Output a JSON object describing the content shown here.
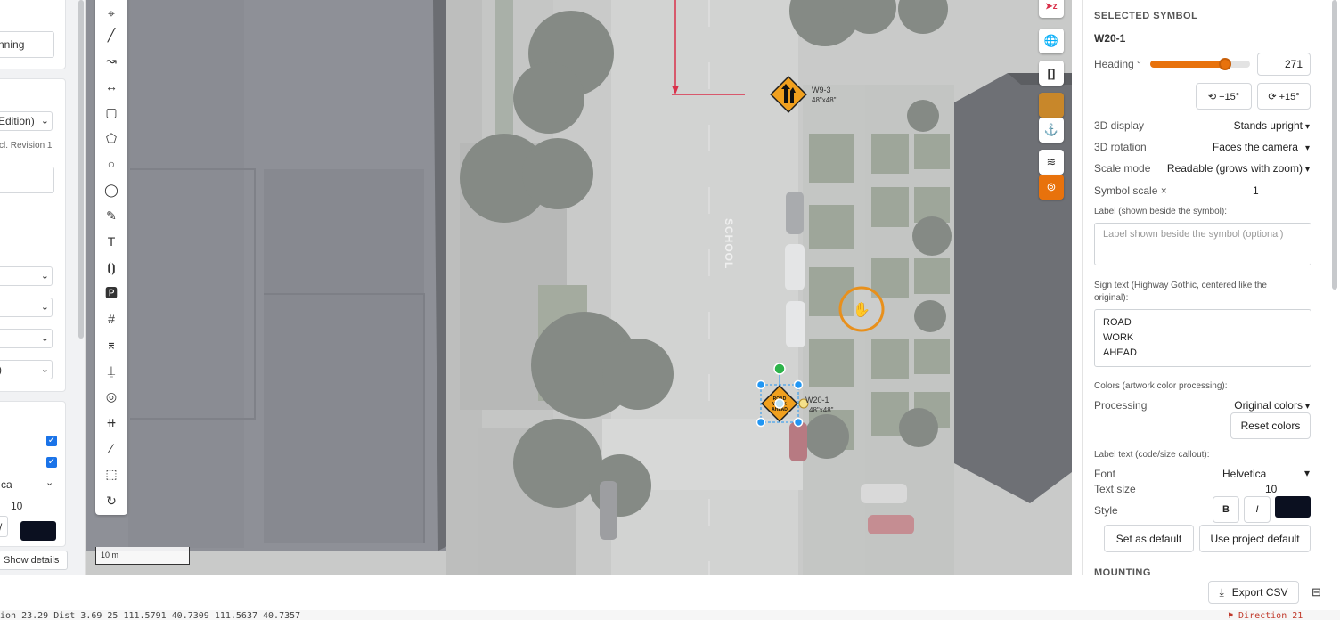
{
  "left_panel": {
    "field_top": "nning",
    "edition_select": "Edition)",
    "revision_text": "cl. Revision 1",
    "font_select": "ca",
    "text_size": "10",
    "style_italic": "/",
    "text_color": "#0b1020",
    "show_details": "Show details"
  },
  "map": {
    "scale_label": "10 m",
    "signs": [
      {
        "code": "W9-3",
        "size": "48\"x48\""
      },
      {
        "code": "W20-1",
        "size": "48\"x48\"",
        "text": "ROAD WORK AHEAD"
      }
    ],
    "pavement_marking": "SCHOOL"
  },
  "toolbar": {
    "tools": [
      {
        "name": "point-tool-icon",
        "glyph": "⌖"
      },
      {
        "name": "line-tool-icon",
        "glyph": "╱"
      },
      {
        "name": "curve-tool-icon",
        "glyph": "↝"
      },
      {
        "name": "measure-tool-icon",
        "glyph": "↔"
      },
      {
        "name": "rectangle-tool-icon",
        "glyph": "▢"
      },
      {
        "name": "polygon-tool-icon",
        "glyph": "⬠"
      },
      {
        "name": "circle-tool-icon",
        "glyph": "○"
      },
      {
        "name": "ellipse-tool-icon",
        "glyph": "◯"
      },
      {
        "name": "pencil-tool-icon",
        "glyph": "✎"
      },
      {
        "name": "text-tool-icon",
        "glyph": "T"
      },
      {
        "name": "label-tool-icon",
        "glyph": "⦗⦘"
      },
      {
        "name": "parking-tool-icon",
        "glyph": "🅿"
      },
      {
        "name": "crosswalk-tool-icon",
        "glyph": "#"
      },
      {
        "name": "path-tool-icon",
        "glyph": "⌆"
      },
      {
        "name": "barricade-tool-icon",
        "glyph": "⍊"
      },
      {
        "name": "target-tool-icon",
        "glyph": "◎"
      },
      {
        "name": "rail-tool-icon",
        "glyph": "⧺"
      },
      {
        "name": "brush-tool-icon",
        "glyph": "⁄"
      },
      {
        "name": "area-select-tool-icon",
        "glyph": "⬚"
      },
      {
        "name": "rotate-tool-icon",
        "glyph": "↻"
      }
    ]
  },
  "map_controls": {
    "north_label": "➤z",
    "globe": "🌐",
    "bracket": "[]",
    "anchor": "⚓",
    "layers": "≋",
    "active": "⚑"
  },
  "panel": {
    "section_title": "SELECTED SYMBOL",
    "symbol_code": "W20-1",
    "heading_label": "Heading °",
    "heading_value": "271",
    "heading_fraction": 0.75,
    "rotate_minus": "⟲ −15°",
    "rotate_plus": "⟳ +15°",
    "display_label": "3D display",
    "display_value": "Stands upright",
    "rotation_label": "3D rotation",
    "rotation_value": "Faces the camera",
    "scale_mode_label": "Scale mode",
    "scale_mode_value": "Readable (grows with zoom)",
    "symbol_scale_label": "Symbol scale ×",
    "symbol_scale_value": "1",
    "label_title": "Label (shown beside the symbol):",
    "label_placeholder": "Label shown beside the symbol (optional)",
    "sign_text_title": "Sign text (Highway Gothic, centered like the original):",
    "sign_text_lines": [
      "ROAD",
      "WORK",
      "AHEAD"
    ],
    "colors_title": "Colors (artwork color processing):",
    "processing_label": "Processing",
    "processing_value": "Original colors",
    "reset_colors": "Reset colors",
    "label_text_title": "Label text (code/size callout):",
    "font_label": "Font",
    "font_value": "Helvetica",
    "text_size_label": "Text size",
    "text_size_value": "10",
    "style_label": "Style",
    "bold": "B",
    "italic": "I",
    "style_color": "#0b1020",
    "set_default": "Set as default",
    "project_default": "Use project default",
    "mounting": "MOUNTING"
  },
  "bottom": {
    "export_csv": "Export CSV"
  },
  "status": {
    "text": "ion  23.29   Dist  3.69   25      111.5791   40.7309     111.5637   40.7357",
    "right": "⚑ Direction  21"
  },
  "colors": {
    "accent": "#e8720c",
    "map_control_active": "#e8720c",
    "sign_orange": "#f1a01e",
    "selection_blue": "#2196f3",
    "handle_green": "#2db34a",
    "red_line": "#d9304a"
  }
}
